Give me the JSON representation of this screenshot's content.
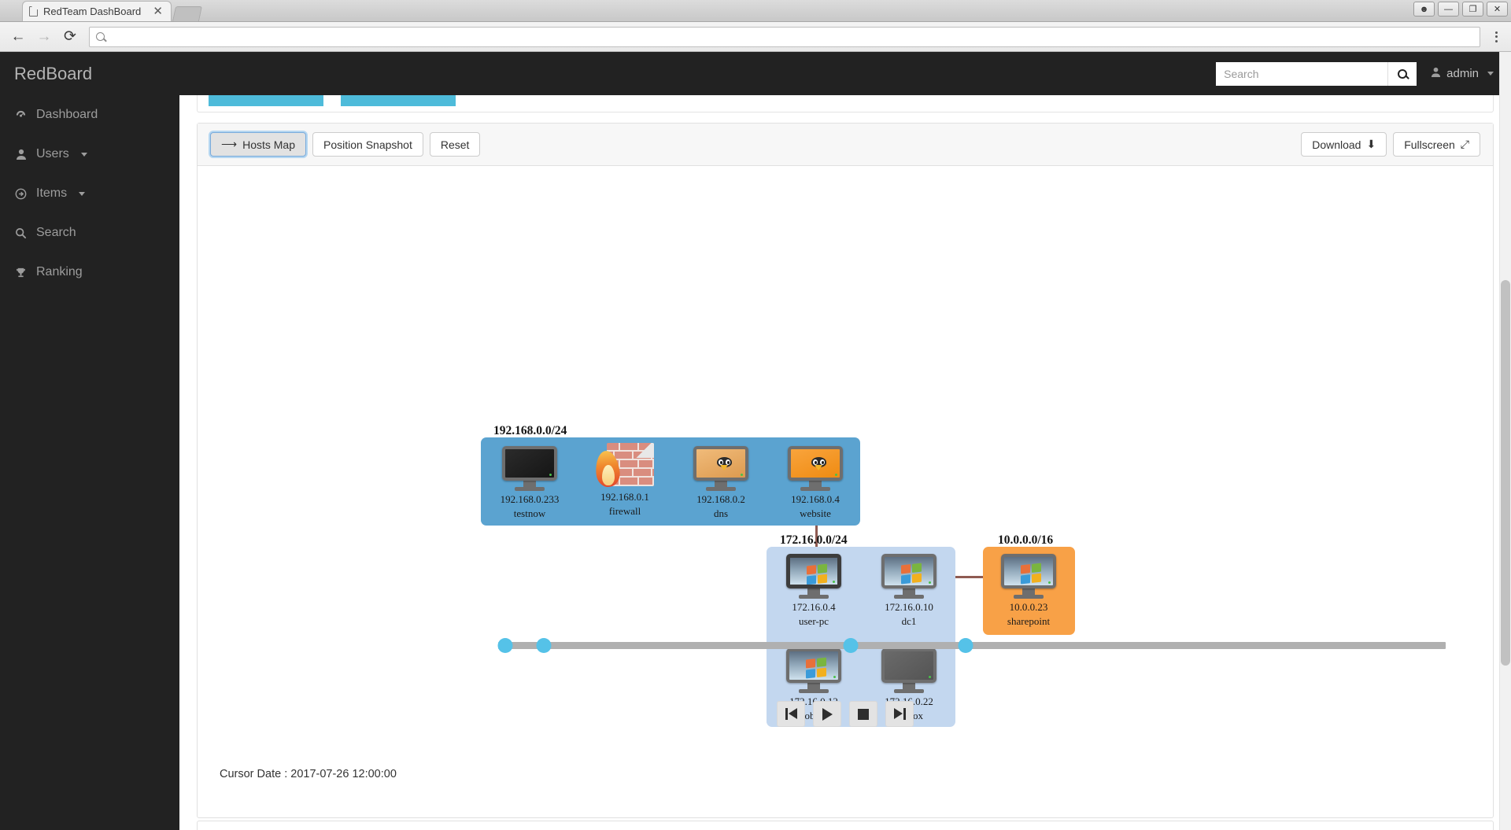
{
  "browser": {
    "tab_title": "RedTeam DashBoard",
    "tab_close": "✕",
    "url_value": "",
    "back_icon": "←",
    "forward_icon": "→",
    "reload_icon": "⟳",
    "win_profile": "☻",
    "win_minimize": "—",
    "win_maximize": "❐",
    "win_close": "✕"
  },
  "sidebar": {
    "brand": "RedBoard",
    "items": [
      {
        "label": "Dashboard",
        "icon": "speedometer-icon",
        "glyph": "◕",
        "has_caret": false
      },
      {
        "label": "Users",
        "icon": "user-icon",
        "glyph": "👤",
        "has_caret": true
      },
      {
        "label": "Items",
        "icon": "arrow-circle-icon",
        "glyph": "◉",
        "has_caret": true
      },
      {
        "label": "Search",
        "icon": "search-icon",
        "glyph": "",
        "has_caret": false
      },
      {
        "label": "Ranking",
        "icon": "trophy-icon",
        "glyph": "🏆",
        "has_caret": false
      }
    ]
  },
  "header": {
    "search_placeholder": "Search",
    "search_value": "",
    "user_label": "admin"
  },
  "map_toolbar": {
    "hosts_map": "Hosts Map",
    "hosts_map_arrow": "⟶",
    "position_snapshot": "Position Snapshot",
    "reset": "Reset",
    "download": "Download",
    "download_icon": "⬇",
    "fullscreen": "Fullscreen",
    "fullscreen_icon": "⤢"
  },
  "map": {
    "subnets": [
      {
        "label": "192.168.0.0/24",
        "color": "#5ba3d0",
        "hosts": [
          {
            "ip": "192.168.0.233",
            "name": "testnow",
            "type": "monitor-off"
          },
          {
            "ip": "192.168.0.1",
            "name": "firewall",
            "type": "firewall"
          },
          {
            "ip": "192.168.0.2",
            "name": "dns",
            "type": "linux-tan"
          },
          {
            "ip": "192.168.0.4",
            "name": "website",
            "type": "linux-orange"
          }
        ]
      },
      {
        "label": "172.16.0.0/24",
        "color": "#c3d7ef",
        "hosts": [
          {
            "ip": "172.16.0.4",
            "name": "user-pc",
            "type": "windows",
            "focused": true
          },
          {
            "ip": "172.16.0.10",
            "name": "dc1",
            "type": "windows"
          },
          {
            "ip": "172.16.0.12",
            "name": "bob-pc",
            "type": "windows"
          },
          {
            "ip": "172.16.0.22",
            "name": "redbox",
            "type": "monitor-gray"
          }
        ]
      },
      {
        "label": "10.0.0.0/16",
        "color": "#f8a council",
        "hosts": [
          {
            "ip": "10.0.0.23",
            "name": "sharepoint",
            "type": "windows"
          }
        ]
      }
    ],
    "link_color": "#8f5b52"
  },
  "timeline": {
    "handle_positions_pct": [
      0,
      3.2,
      24.2,
      32.2,
      74.5,
      77.3
    ],
    "current_index": 5
  },
  "playback": {
    "skip_start": "skip-to-start",
    "play": "play",
    "stop": "stop",
    "skip_end": "skip-to-end"
  },
  "footer": {
    "cursor_date": "Cursor Date : 2017-07-26 12:00:00"
  }
}
